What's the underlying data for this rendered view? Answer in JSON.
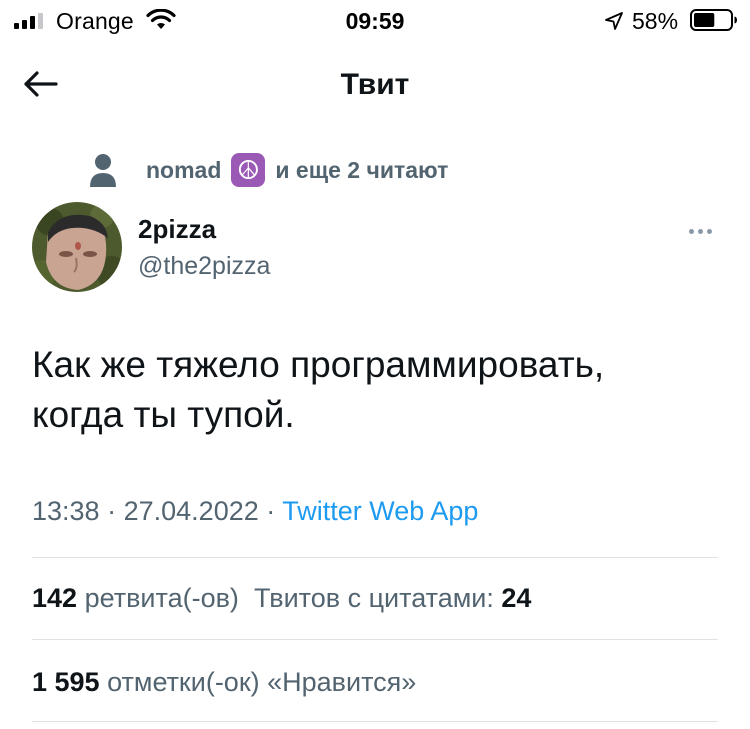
{
  "status_bar": {
    "carrier": "Orange",
    "time": "09:59",
    "battery_percent": "58%",
    "battery_level": 0.58,
    "signal_icon": "signal-bars-icon",
    "wifi_icon": "wifi-icon",
    "location_icon": "location-arrow-icon"
  },
  "nav": {
    "title": "Твит",
    "back_icon": "arrow-left-icon"
  },
  "social_context": {
    "icon": "person-icon",
    "name": "nomad",
    "emoji": "☮",
    "text": "и еще 2 читают"
  },
  "tweet": {
    "display_name": "2pizza",
    "handle": "@the2pizza",
    "text_line1": "Как же тяжело программировать,",
    "text_line2": "когда ты тупой.",
    "time": "13:38",
    "date": "27.04.2022",
    "separator": "·",
    "source": "Twitter Web App"
  },
  "stats": {
    "retweets_count": "142",
    "retweets_label": "ретвита(-ов)",
    "quotes_label": "Твитов с цитатами:",
    "quotes_count": "24",
    "likes_count": "1 595",
    "likes_label": "отметки(-ок) «Нравится»"
  },
  "colors": {
    "text_primary": "#0f1419",
    "text_secondary": "#536471",
    "link": "#1d9bf0",
    "divider": "#dfe3e6"
  }
}
